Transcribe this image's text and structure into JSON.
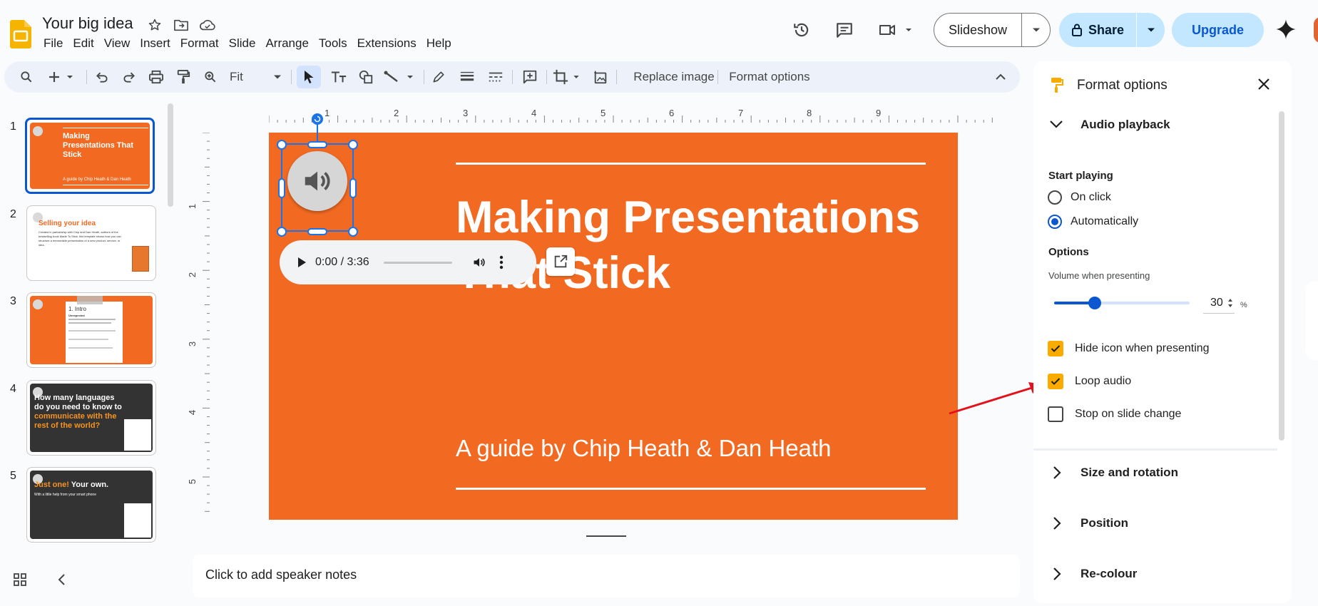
{
  "app": {
    "doc_title": "Your big idea",
    "menu": [
      "File",
      "Edit",
      "View",
      "Insert",
      "Format",
      "Slide",
      "Arrange",
      "Tools",
      "Extensions",
      "Help"
    ],
    "slideshow_label": "Slideshow",
    "share_label": "Share",
    "upgrade_label": "Upgrade"
  },
  "toolbar": {
    "zoom_value": "Fit",
    "replace_image_label": "Replace image",
    "format_options_label": "Format options"
  },
  "ruler": {
    "h_labels": [
      "1",
      "2",
      "3",
      "4",
      "5",
      "6",
      "7",
      "8",
      "9"
    ],
    "v_labels": [
      "1",
      "2",
      "3",
      "4",
      "5"
    ]
  },
  "filmstrip": {
    "slides": [
      {
        "num": "1",
        "title": "Making Presentations That Stick",
        "sub": "A guide by Chip Heath & Dan Heath"
      },
      {
        "num": "2",
        "title": "Selling your idea",
        "body": "Created in partnership with Chip and Dan Heath, authors of the bestselling book Made To Stick, this template shows how you can structure a memorable presentation of a new product, service, or idea."
      },
      {
        "num": "3",
        "title": "1. Intro",
        "body": "Unexpected"
      },
      {
        "num": "4",
        "title_a": "How many languages do you need to know to ",
        "title_b": "communicate with the rest of the world?"
      },
      {
        "num": "5",
        "title_a": "Just one! ",
        "title_b": "Your own.",
        "sub": "With a little help from your smart phone"
      }
    ]
  },
  "slide": {
    "title": "Making Presentations That Stick",
    "subtitle": "A guide by Chip Heath & Dan Heath"
  },
  "audio": {
    "time": "0:00 / 3:36",
    "progress": 0
  },
  "notes": {
    "placeholder": "Click to add speaker notes"
  },
  "panel": {
    "title": "Format options",
    "section_audio": "Audio playback",
    "start_playing": "Start playing",
    "on_click": "On click",
    "automatically": "Automatically",
    "options": "Options",
    "volume_label": "Volume when presenting",
    "volume_value": "30",
    "volume_unit": "%",
    "hide_icon": "Hide icon when presenting",
    "loop_audio": "Loop audio",
    "stop_on_change": "Stop on slide change",
    "section_size": "Size and rotation",
    "section_position": "Position",
    "section_recolour": "Re-colour"
  },
  "colors": {
    "slide_bg": "#f26a22",
    "accent_blue": "#0b57d0",
    "checkbox": "#f9ab00",
    "annotation_arrow": "#e3111c"
  }
}
